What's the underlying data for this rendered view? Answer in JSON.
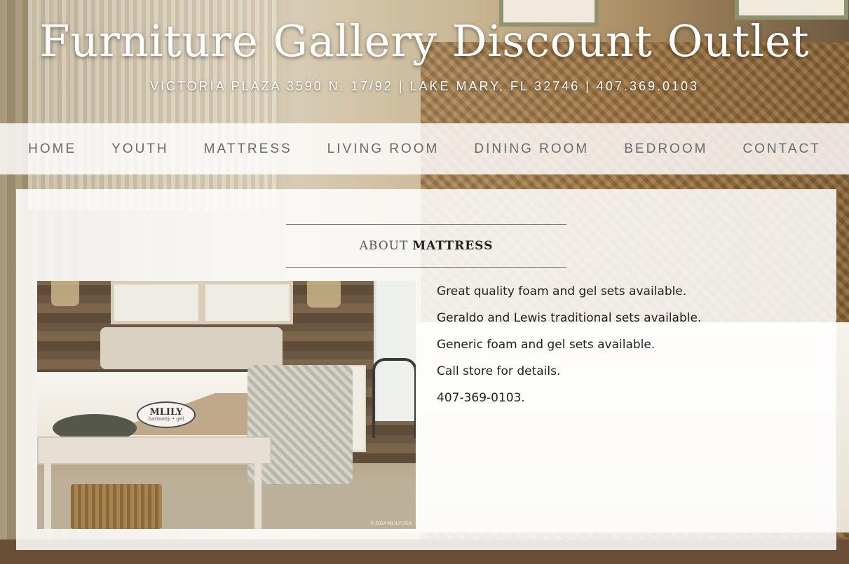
{
  "header": {
    "title": "Furniture Gallery Discount Outlet",
    "subtitle": "VICTORIA PLAZA 3590 N. 17/92 | LAKE MARY, FL 32746 | 407.369.0103"
  },
  "nav": {
    "items": [
      {
        "label": "HOME"
      },
      {
        "label": "YOUTH"
      },
      {
        "label": "MATTRESS"
      },
      {
        "label": "LIVING ROOM"
      },
      {
        "label": "DINING ROOM"
      },
      {
        "label": "BEDROOM"
      },
      {
        "label": "CONTACT"
      }
    ]
  },
  "section": {
    "heading_prefix": "ABOUT",
    "heading_main": "MATTRESS"
  },
  "product_image": {
    "brand": "MLILY",
    "brand_sub": "harmony • gel",
    "credit": "© 2014 MLILYUSA"
  },
  "details": [
    "Great quality foam and gel sets available.",
    "Geraldo and Lewis traditional sets available.",
    "Generic foam and gel sets available.",
    "Call store for details.",
    "407-369-0103."
  ],
  "colors": {
    "nav_text": "#6a6a6a",
    "header_text": "#ffffff",
    "body_text": "#1f1f1f"
  }
}
